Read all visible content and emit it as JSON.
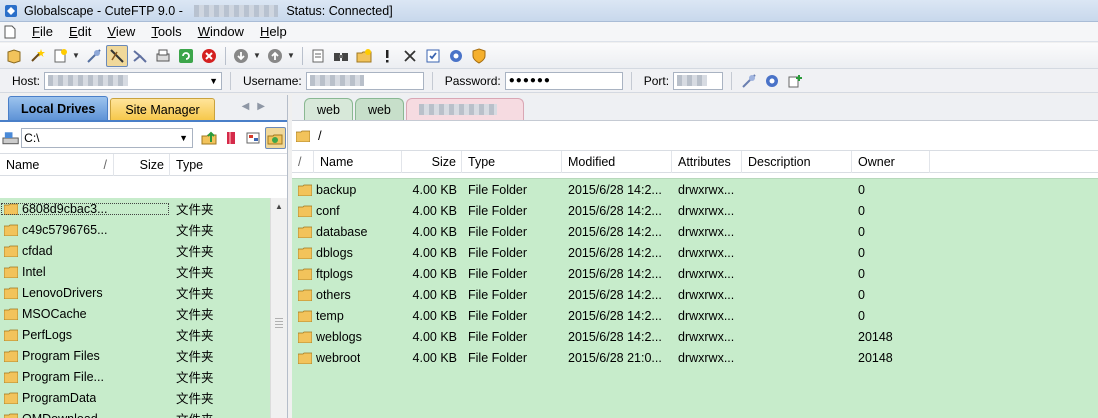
{
  "window": {
    "title_prefix": "Globalscape - CuteFTP 9.0 - ",
    "title_status": "Status: Connected]"
  },
  "menu": {
    "items": [
      {
        "key": "F",
        "rest": "ile"
      },
      {
        "key": "E",
        "rest": "dit"
      },
      {
        "key": "V",
        "rest": "iew"
      },
      {
        "key": "T",
        "rest": "ools"
      },
      {
        "key": "W",
        "rest": "indow"
      },
      {
        "key": "H",
        "rest": "elp"
      }
    ]
  },
  "connection": {
    "host_label": "Host:",
    "username_label": "Username:",
    "password_label": "Password:",
    "password_value": "●●●●●●",
    "port_label": "Port:"
  },
  "left": {
    "tabs": {
      "local": "Local Drives",
      "site": "Site Manager"
    },
    "drive": "C:\\",
    "columns": {
      "name": "Name",
      "sort": "/",
      "size": "Size",
      "type": "Type"
    },
    "rows": [
      {
        "name": "6808d9cbac3...",
        "type": "文件夹"
      },
      {
        "name": "c49c5796765...",
        "type": "文件夹"
      },
      {
        "name": "cfdad",
        "type": "文件夹"
      },
      {
        "name": "Intel",
        "type": "文件夹"
      },
      {
        "name": "LenovoDrivers",
        "type": "文件夹"
      },
      {
        "name": "MSOCache",
        "type": "文件夹"
      },
      {
        "name": "PerfLogs",
        "type": "文件夹"
      },
      {
        "name": "Program Files",
        "type": "文件夹"
      },
      {
        "name": "Program File...",
        "type": "文件夹"
      },
      {
        "name": "ProgramData",
        "type": "文件夹"
      },
      {
        "name": "QMDownload",
        "type": "文件夹"
      }
    ]
  },
  "right": {
    "tabs": [
      "web",
      "web"
    ],
    "path": "/",
    "columns": {
      "sort": "/",
      "name": "Name",
      "size": "Size",
      "type": "Type",
      "modified": "Modified",
      "attributes": "Attributes",
      "description": "Description",
      "owner": "Owner"
    },
    "rows": [
      {
        "name": "backup",
        "size": "4.00 KB",
        "type": "File Folder",
        "modified": "2015/6/28 14:2...",
        "attributes": "drwxrwx...",
        "owner": "0"
      },
      {
        "name": "conf",
        "size": "4.00 KB",
        "type": "File Folder",
        "modified": "2015/6/28 14:2...",
        "attributes": "drwxrwx...",
        "owner": "0"
      },
      {
        "name": "database",
        "size": "4.00 KB",
        "type": "File Folder",
        "modified": "2015/6/28 14:2...",
        "attributes": "drwxrwx...",
        "owner": "0"
      },
      {
        "name": "dblogs",
        "size": "4.00 KB",
        "type": "File Folder",
        "modified": "2015/6/28 14:2...",
        "attributes": "drwxrwx...",
        "owner": "0"
      },
      {
        "name": "ftplogs",
        "size": "4.00 KB",
        "type": "File Folder",
        "modified": "2015/6/28 14:2...",
        "attributes": "drwxrwx...",
        "owner": "0"
      },
      {
        "name": "others",
        "size": "4.00 KB",
        "type": "File Folder",
        "modified": "2015/6/28 14:2...",
        "attributes": "drwxrwx...",
        "owner": "0"
      },
      {
        "name": "temp",
        "size": "4.00 KB",
        "type": "File Folder",
        "modified": "2015/6/28 14:2...",
        "attributes": "drwxrwx...",
        "owner": "0"
      },
      {
        "name": "weblogs",
        "size": "4.00 KB",
        "type": "File Folder",
        "modified": "2015/6/28 14:2...",
        "attributes": "drwxrwx...",
        "owner": "20148"
      },
      {
        "name": "webroot",
        "size": "4.00 KB",
        "type": "File Folder",
        "modified": "2015/6/28 21:0...",
        "attributes": "drwxrwx...",
        "owner": "20148"
      }
    ]
  },
  "colors": {
    "list_bg": "#c7eccb",
    "tab_active": "#5e93d6",
    "tab_site": "#f6c84b"
  }
}
